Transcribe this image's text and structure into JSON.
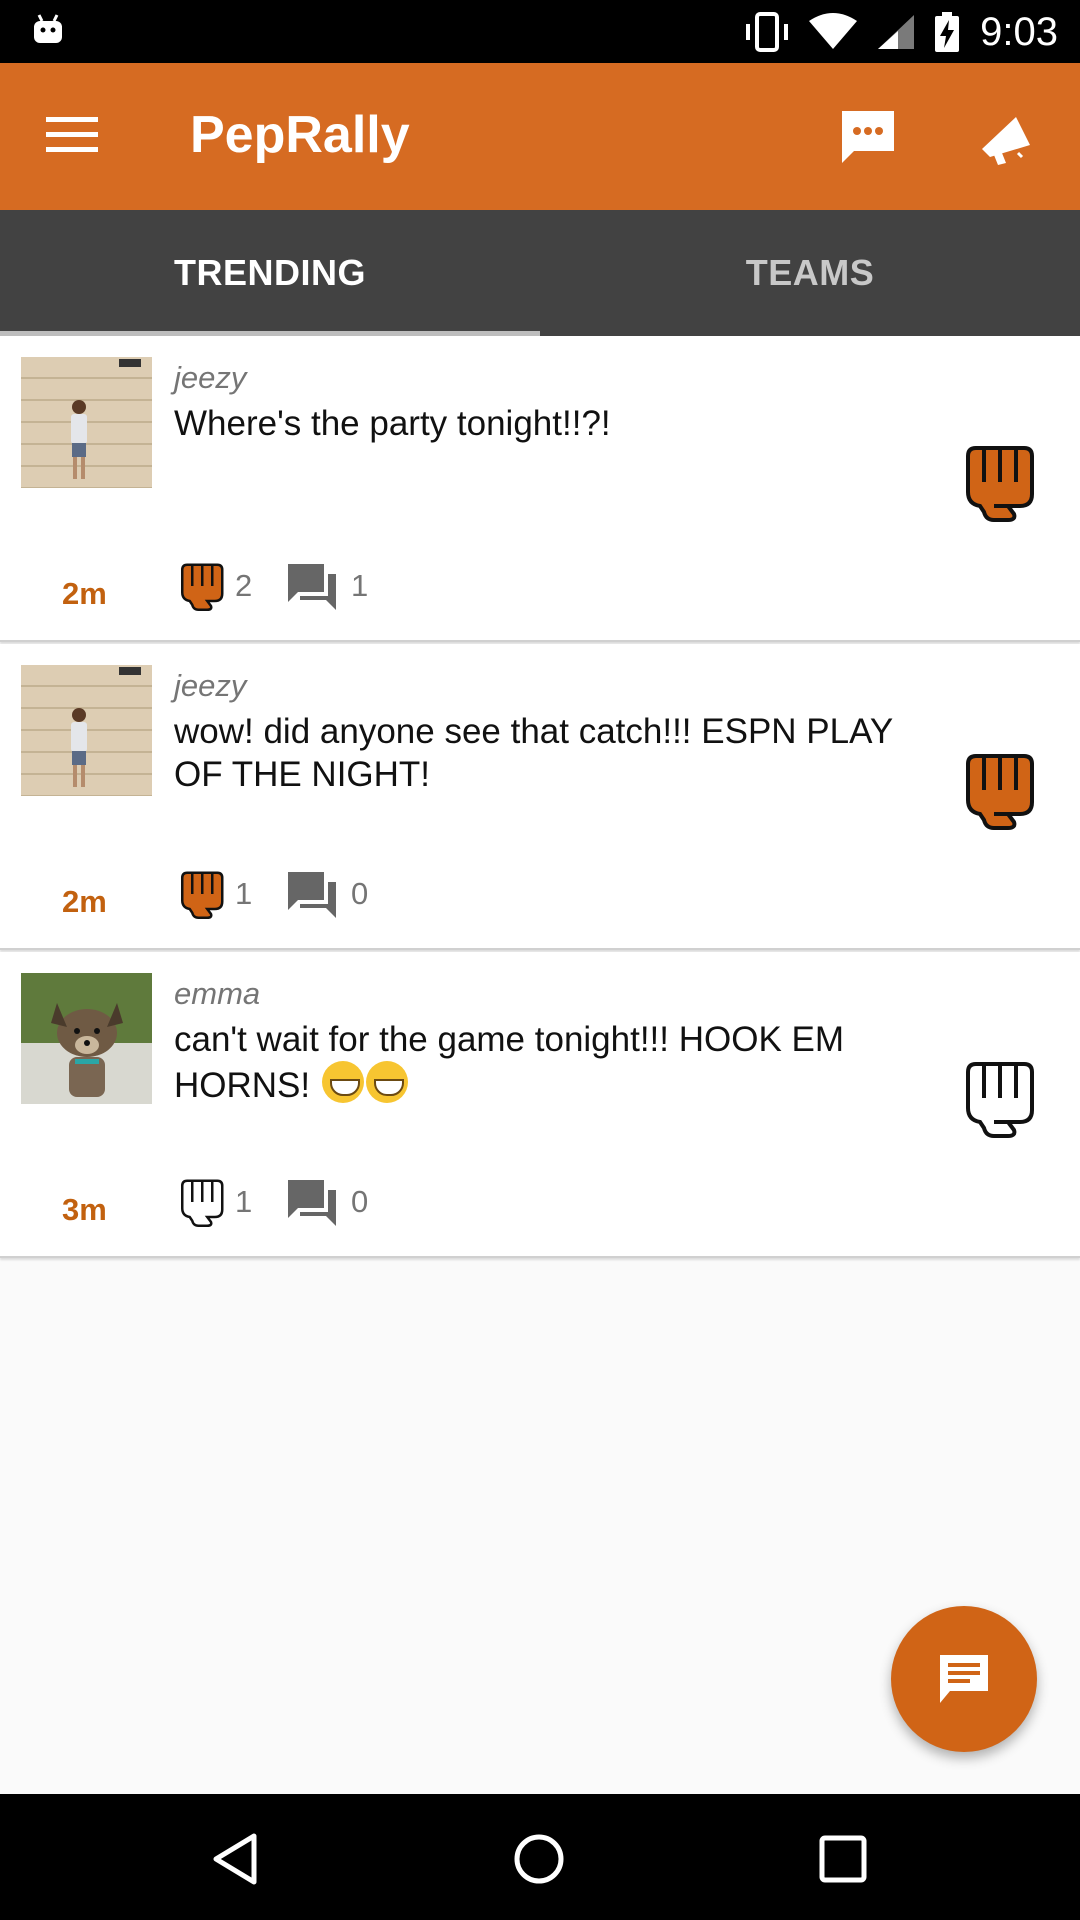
{
  "status_bar": {
    "time": "9:03",
    "icons": [
      "android-icon",
      "vibrate-icon",
      "wifi-icon",
      "signal-icon",
      "battery-charging-icon"
    ]
  },
  "app_bar": {
    "title": "PepRally",
    "icons": [
      "menu-icon",
      "chat-icon",
      "megaphone-icon"
    ],
    "accent_color": "#d66b22"
  },
  "tabs": [
    {
      "label": "TRENDING",
      "selected": true
    },
    {
      "label": "TEAMS",
      "selected": false
    }
  ],
  "posts": [
    {
      "username": "jeezy",
      "text": "Where's the party tonight!!?!",
      "time": "2m",
      "likes": "2",
      "comments": "1",
      "liked": true
    },
    {
      "username": "jeezy",
      "text": "wow! did anyone see that catch!!! ESPN PLAY OF THE NIGHT!",
      "time": "2m",
      "likes": "1",
      "comments": "0",
      "liked": true
    },
    {
      "username": "emma",
      "text": "can't wait for the game tonight!!! HOOK EM HORNS!",
      "text_emoji": "grinning-emoji x2",
      "time": "3m",
      "likes": "1",
      "comments": "0",
      "liked": false
    }
  ],
  "fab": {
    "icon": "new-post-icon",
    "color": "#d06416"
  },
  "nav_bar": {
    "icons": [
      "back-icon",
      "home-icon",
      "recents-icon"
    ]
  }
}
